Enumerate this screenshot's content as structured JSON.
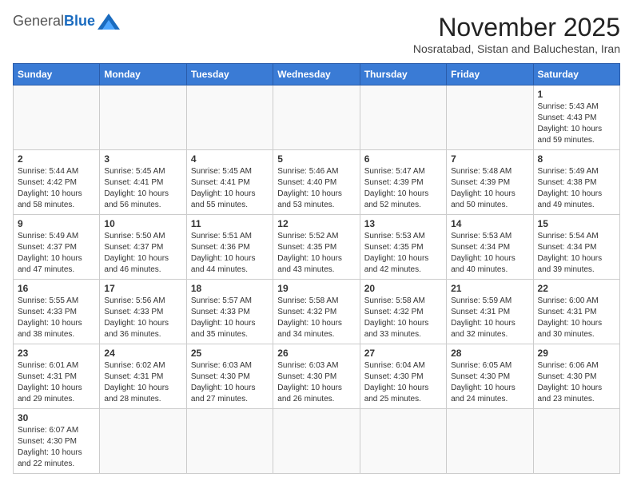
{
  "header": {
    "logo_general": "General",
    "logo_blue": "Blue",
    "month_year": "November 2025",
    "location": "Nosratabad, Sistan and Baluchestan, Iran"
  },
  "days_of_week": [
    "Sunday",
    "Monday",
    "Tuesday",
    "Wednesday",
    "Thursday",
    "Friday",
    "Saturday"
  ],
  "weeks": [
    [
      {
        "day": "",
        "info": ""
      },
      {
        "day": "",
        "info": ""
      },
      {
        "day": "",
        "info": ""
      },
      {
        "day": "",
        "info": ""
      },
      {
        "day": "",
        "info": ""
      },
      {
        "day": "",
        "info": ""
      },
      {
        "day": "1",
        "info": "Sunrise: 5:43 AM\nSunset: 4:43 PM\nDaylight: 10 hours and 59 minutes."
      }
    ],
    [
      {
        "day": "2",
        "info": "Sunrise: 5:44 AM\nSunset: 4:42 PM\nDaylight: 10 hours and 58 minutes."
      },
      {
        "day": "3",
        "info": "Sunrise: 5:45 AM\nSunset: 4:41 PM\nDaylight: 10 hours and 56 minutes."
      },
      {
        "day": "4",
        "info": "Sunrise: 5:45 AM\nSunset: 4:41 PM\nDaylight: 10 hours and 55 minutes."
      },
      {
        "day": "5",
        "info": "Sunrise: 5:46 AM\nSunset: 4:40 PM\nDaylight: 10 hours and 53 minutes."
      },
      {
        "day": "6",
        "info": "Sunrise: 5:47 AM\nSunset: 4:39 PM\nDaylight: 10 hours and 52 minutes."
      },
      {
        "day": "7",
        "info": "Sunrise: 5:48 AM\nSunset: 4:39 PM\nDaylight: 10 hours and 50 minutes."
      },
      {
        "day": "8",
        "info": "Sunrise: 5:49 AM\nSunset: 4:38 PM\nDaylight: 10 hours and 49 minutes."
      }
    ],
    [
      {
        "day": "9",
        "info": "Sunrise: 5:49 AM\nSunset: 4:37 PM\nDaylight: 10 hours and 47 minutes."
      },
      {
        "day": "10",
        "info": "Sunrise: 5:50 AM\nSunset: 4:37 PM\nDaylight: 10 hours and 46 minutes."
      },
      {
        "day": "11",
        "info": "Sunrise: 5:51 AM\nSunset: 4:36 PM\nDaylight: 10 hours and 44 minutes."
      },
      {
        "day": "12",
        "info": "Sunrise: 5:52 AM\nSunset: 4:35 PM\nDaylight: 10 hours and 43 minutes."
      },
      {
        "day": "13",
        "info": "Sunrise: 5:53 AM\nSunset: 4:35 PM\nDaylight: 10 hours and 42 minutes."
      },
      {
        "day": "14",
        "info": "Sunrise: 5:53 AM\nSunset: 4:34 PM\nDaylight: 10 hours and 40 minutes."
      },
      {
        "day": "15",
        "info": "Sunrise: 5:54 AM\nSunset: 4:34 PM\nDaylight: 10 hours and 39 minutes."
      }
    ],
    [
      {
        "day": "16",
        "info": "Sunrise: 5:55 AM\nSunset: 4:33 PM\nDaylight: 10 hours and 38 minutes."
      },
      {
        "day": "17",
        "info": "Sunrise: 5:56 AM\nSunset: 4:33 PM\nDaylight: 10 hours and 36 minutes."
      },
      {
        "day": "18",
        "info": "Sunrise: 5:57 AM\nSunset: 4:33 PM\nDaylight: 10 hours and 35 minutes."
      },
      {
        "day": "19",
        "info": "Sunrise: 5:58 AM\nSunset: 4:32 PM\nDaylight: 10 hours and 34 minutes."
      },
      {
        "day": "20",
        "info": "Sunrise: 5:58 AM\nSunset: 4:32 PM\nDaylight: 10 hours and 33 minutes."
      },
      {
        "day": "21",
        "info": "Sunrise: 5:59 AM\nSunset: 4:31 PM\nDaylight: 10 hours and 32 minutes."
      },
      {
        "day": "22",
        "info": "Sunrise: 6:00 AM\nSunset: 4:31 PM\nDaylight: 10 hours and 30 minutes."
      }
    ],
    [
      {
        "day": "23",
        "info": "Sunrise: 6:01 AM\nSunset: 4:31 PM\nDaylight: 10 hours and 29 minutes."
      },
      {
        "day": "24",
        "info": "Sunrise: 6:02 AM\nSunset: 4:31 PM\nDaylight: 10 hours and 28 minutes."
      },
      {
        "day": "25",
        "info": "Sunrise: 6:03 AM\nSunset: 4:30 PM\nDaylight: 10 hours and 27 minutes."
      },
      {
        "day": "26",
        "info": "Sunrise: 6:03 AM\nSunset: 4:30 PM\nDaylight: 10 hours and 26 minutes."
      },
      {
        "day": "27",
        "info": "Sunrise: 6:04 AM\nSunset: 4:30 PM\nDaylight: 10 hours and 25 minutes."
      },
      {
        "day": "28",
        "info": "Sunrise: 6:05 AM\nSunset: 4:30 PM\nDaylight: 10 hours and 24 minutes."
      },
      {
        "day": "29",
        "info": "Sunrise: 6:06 AM\nSunset: 4:30 PM\nDaylight: 10 hours and 23 minutes."
      }
    ],
    [
      {
        "day": "30",
        "info": "Sunrise: 6:07 AM\nSunset: 4:30 PM\nDaylight: 10 hours and 22 minutes."
      },
      {
        "day": "",
        "info": ""
      },
      {
        "day": "",
        "info": ""
      },
      {
        "day": "",
        "info": ""
      },
      {
        "day": "",
        "info": ""
      },
      {
        "day": "",
        "info": ""
      },
      {
        "day": "",
        "info": ""
      }
    ]
  ]
}
